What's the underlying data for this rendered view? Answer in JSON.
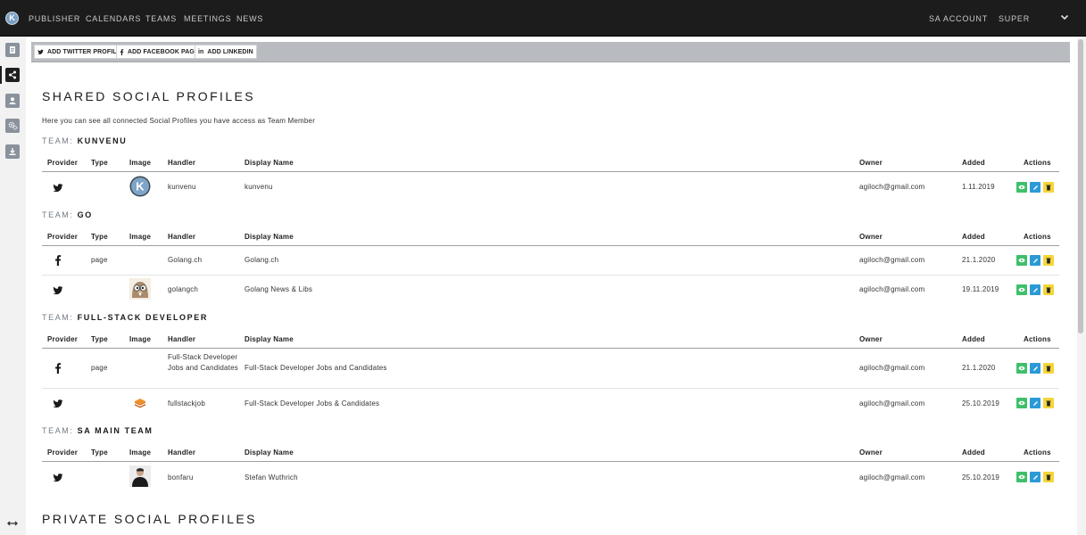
{
  "brand": {
    "logo_letter": "K"
  },
  "nav": {
    "items": [
      {
        "label": "PUBLISHER"
      },
      {
        "label": "CALENDARS"
      },
      {
        "label": "TEAMS"
      },
      {
        "label": "MEETINGS"
      },
      {
        "label": "NEWS"
      }
    ],
    "account": "SA ACCOUNT",
    "user": "SUPER"
  },
  "toolbar": {
    "twitter_label": "ADD TWITTER PROFILE",
    "facebook_label": "ADD FACEBOOK PAGE",
    "linkedin_label": "ADD LINKEDIN"
  },
  "shared": {
    "title": "SHARED SOCIAL PROFILES",
    "intro": "Here you can see all connected Social Profiles you have access as Team Member"
  },
  "columns": {
    "provider": "Provider",
    "type": "Type",
    "image": "Image",
    "handler": "Handler",
    "display_name": "Display Name",
    "owner": "Owner",
    "added": "Added",
    "actions": "Actions"
  },
  "team_prefix": "TEAM:",
  "teams": [
    {
      "name": "KUNVENU",
      "rows": [
        {
          "provider": "twitter",
          "type": "",
          "image": "kunvenu-logo",
          "handler": "kunvenu",
          "display_name": "kunvenu",
          "owner": "agiloch@gmail.com",
          "added": "1.11.2019"
        }
      ]
    },
    {
      "name": "GO",
      "rows": [
        {
          "provider": "facebook",
          "type": "page",
          "image": "",
          "handler": "Golang.ch",
          "display_name": "Golang.ch",
          "owner": "agiloch@gmail.com",
          "added": "21.1.2020"
        },
        {
          "provider": "twitter",
          "type": "",
          "image": "gopher-avatar",
          "handler": "golangch",
          "display_name": "Golang News & Libs",
          "owner": "agiloch@gmail.com",
          "added": "19.11.2019"
        }
      ]
    },
    {
      "name": "FULL-STACK DEVELOPER",
      "rows": [
        {
          "provider": "facebook",
          "type": "page",
          "image": "",
          "handler": "Full-Stack Developer Jobs and Candidates",
          "display_name": "Full-Stack Developer Jobs and Candidates",
          "owner": "agiloch@gmail.com",
          "added": "21.1.2020"
        },
        {
          "provider": "twitter",
          "type": "",
          "image": "stack-logo",
          "handler": "fullstackjob",
          "display_name": "Full-Stack Developer Jobs & Candidates",
          "owner": "agiloch@gmail.com",
          "added": "25.10.2019"
        }
      ]
    },
    {
      "name": "SA MAIN TEAM",
      "rows": [
        {
          "provider": "twitter",
          "type": "",
          "image": "person-photo",
          "handler": "bonfaru",
          "display_name": "Stefan Wuthrich",
          "owner": "agiloch@gmail.com",
          "added": "25.10.2019"
        }
      ]
    }
  ],
  "private": {
    "title": "PRIVATE SOCIAL PROFILES"
  },
  "colors": {
    "topbar": "#1c1c1c",
    "view": "#3fbf6b",
    "edit": "#2b9ad6",
    "delete": "#f5d63a"
  }
}
